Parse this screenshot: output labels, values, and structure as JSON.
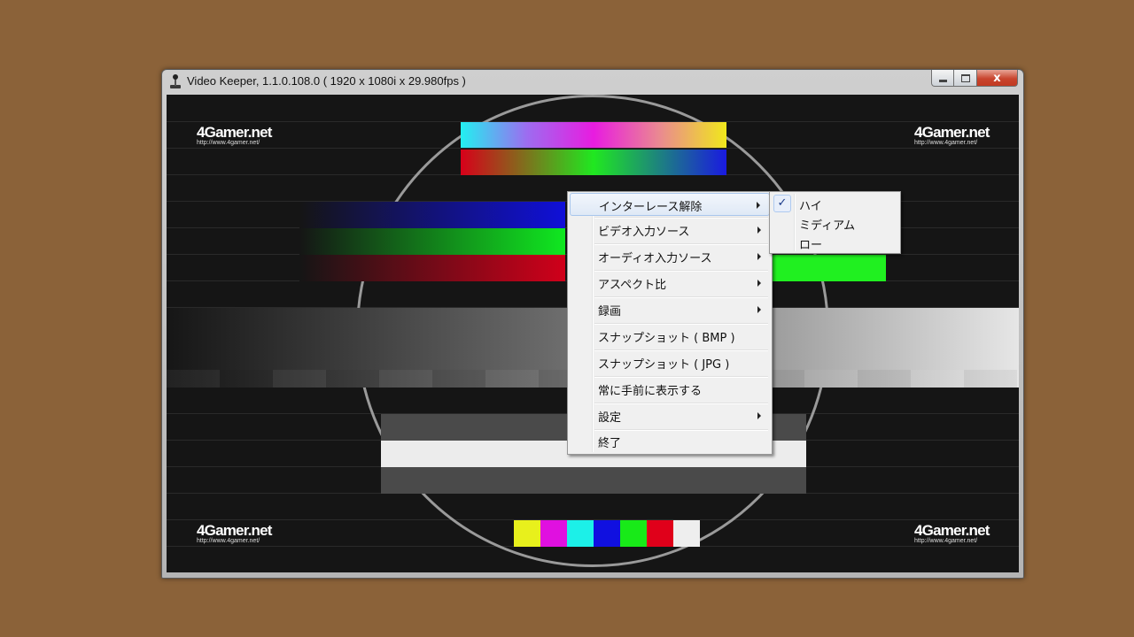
{
  "window": {
    "title": "Video Keeper, 1.1.0.108.0 ( 1920 x 1080i x 29.980fps )",
    "close_glyph": "x"
  },
  "video": {
    "logo_text": "4Gamer.net",
    "logo_url": "http://www.4gamer.net/",
    "swatch_colors": [
      "#e8f01c",
      "#e010e0",
      "#1cf0e8",
      "#1010e0",
      "#18ea18",
      "#e0001a",
      "#eeeeee"
    ]
  },
  "context_menu": {
    "items": [
      {
        "label": "インターレース解除",
        "submenu": true
      },
      {
        "label": "ビデオ入力ソース",
        "submenu": true
      },
      {
        "label": "オーディオ入力ソース",
        "submenu": true
      },
      {
        "label": "アスペクト比",
        "submenu": true
      },
      {
        "label": "録画",
        "submenu": true
      },
      {
        "label": "スナップショット ( BMP )",
        "submenu": false
      },
      {
        "label": "スナップショット ( JPG )",
        "submenu": false
      },
      {
        "label": "常に手前に表示する",
        "submenu": false
      },
      {
        "label": "設定",
        "submenu": true
      },
      {
        "label": "終了",
        "submenu": false
      }
    ]
  },
  "deinterlace_submenu": {
    "check_glyph": "✓",
    "items": [
      {
        "label": "ハイ",
        "checked": true
      },
      {
        "label": "ミディアム",
        "checked": false
      },
      {
        "label": "ロー",
        "checked": false
      }
    ]
  }
}
